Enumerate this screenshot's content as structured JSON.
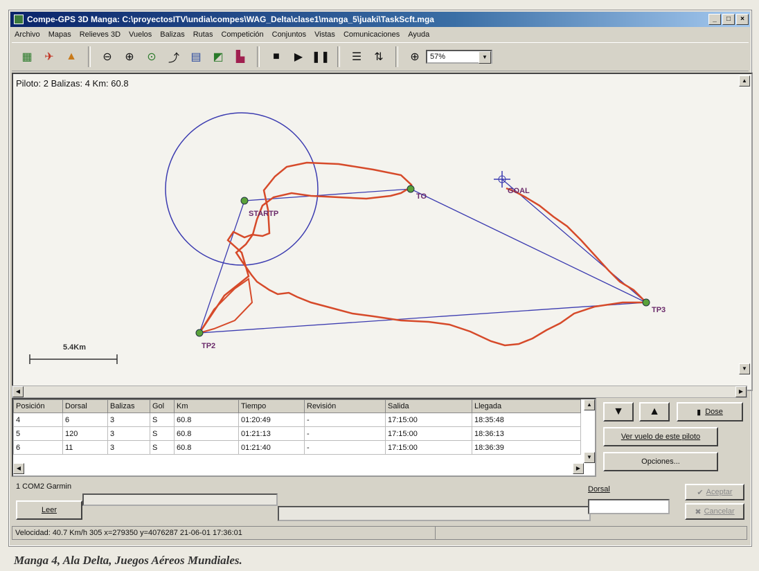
{
  "window": {
    "title": "Compe-GPS 3D  Manga: C:\\proyectosITV\\undia\\compes\\WAG_Delta\\clase1\\manga_5\\juaki\\TaskScft.mga",
    "min": "_",
    "max": "□",
    "close": "×"
  },
  "menu": [
    "Archivo",
    "Mapas",
    "Relieves 3D",
    "Vuelos",
    "Balizas",
    "Rutas",
    "Competición",
    "Conjuntos",
    "Vistas",
    "Comunicaciones",
    "Ayuda"
  ],
  "toolbar": {
    "zoom_value": "57%"
  },
  "map": {
    "info": "Piloto: 2 Balizas: 4 Km: 60.8",
    "scale_label": "5.4Km",
    "waypoints": {
      "startp": "STARTP",
      "to": "TO",
      "goal": "GOAL",
      "tp2": "TP2",
      "tp3": "TP3"
    }
  },
  "table": {
    "headers": [
      "Posición",
      "Dorsal",
      "Balizas",
      "Gol",
      "Km",
      "Tiempo",
      "Revisión",
      "Salida",
      "Llegada"
    ],
    "rows": [
      [
        "4",
        "6",
        "3",
        "S",
        "60.8",
        "01:20:49",
        "-",
        "17:15:00",
        "18:35:48"
      ],
      [
        "5",
        "120",
        "3",
        "S",
        "60.8",
        "01:21:13",
        "-",
        "17:15:00",
        "18:36:13"
      ],
      [
        "6",
        "11",
        "3",
        "S",
        "60.8",
        "01:21:40",
        "-",
        "17:15:00",
        "18:36:39"
      ]
    ]
  },
  "buttons": {
    "close": "Dose",
    "ver_vuelo": "Ver vuelo de este piloto",
    "opciones": "Opciones...",
    "leer": "Leer",
    "aceptar": "Aceptar",
    "cancelar": "Cancelar"
  },
  "comms": {
    "port": "1  COM2   Garmin"
  },
  "dorsal_label": "Dorsal",
  "status": "Velocidad: 40.7 Km/h 305  x=279350  y=4076287 21-06-01 17:36:01",
  "caption": "Manga 4, Ala Delta, Juegos Aéreos Mundiales.",
  "colors": {
    "track": "#d64a2a",
    "route": "#3b3bb0",
    "waypoint": "#5aa23a",
    "titlebar": "#0a246a"
  }
}
